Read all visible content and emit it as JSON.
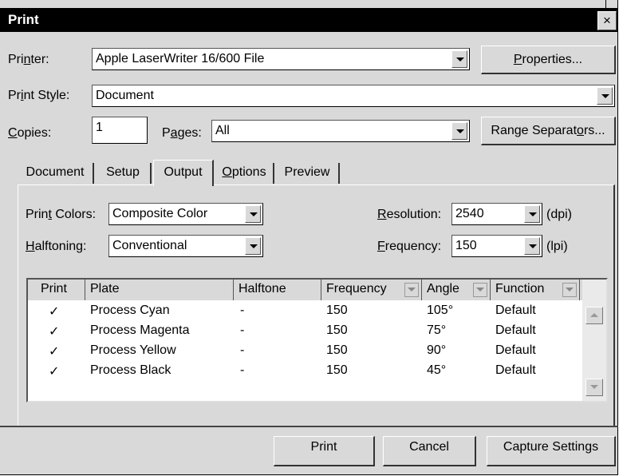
{
  "dialog": {
    "title": "Print",
    "close": "×"
  },
  "printer": {
    "label_pre": "Pri",
    "label_key": "n",
    "label_post": "ter:",
    "value": "Apple LaserWriter 16/600 File",
    "properties_pre": "",
    "properties_key": "P",
    "properties_post": "roperties..."
  },
  "print_style": {
    "label_pre": "Pr",
    "label_key": "i",
    "label_post": "nt Style:",
    "value": "Document"
  },
  "copies": {
    "label_pre": "",
    "label_key": "C",
    "label_post": "opies:",
    "value": "1"
  },
  "pages": {
    "label_pre": "P",
    "label_key": "a",
    "label_post": "ges:",
    "value": "All"
  },
  "range_separators": {
    "pre": "Range Separat",
    "key": "o",
    "post": "rs..."
  },
  "tabs": [
    {
      "label": "Document",
      "active": false
    },
    {
      "label": "Setup",
      "active": false
    },
    {
      "label": "Output",
      "active": true
    },
    {
      "label_pre": "",
      "label_key": "O",
      "label_post": "ptions",
      "active": false
    },
    {
      "label": "Preview",
      "active": false
    }
  ],
  "output": {
    "print_colors": {
      "label_pre": "Prin",
      "label_key": "t",
      "label_post": " Colors:",
      "value": "Composite Color"
    },
    "halftoning": {
      "label_pre": "",
      "label_key": "H",
      "label_post": "alftoning:",
      "value": "Conventional"
    },
    "resolution": {
      "label_pre": "",
      "label_key": "R",
      "label_post": "esolution:",
      "value": "2540",
      "unit": "(dpi)"
    },
    "frequency": {
      "label_pre": "",
      "label_key": "F",
      "label_post": "requency:",
      "value": "150",
      "unit": "(lpi)"
    }
  },
  "plates_table": {
    "columns": [
      "Print",
      "Plate",
      "Halftone",
      "Frequency",
      "Angle",
      "Function"
    ],
    "rows": [
      {
        "print": "✓",
        "plate": "Process Cyan",
        "halftone": "-",
        "frequency": "150",
        "angle": "105°",
        "function": "Default"
      },
      {
        "print": "✓",
        "plate": "Process Magenta",
        "halftone": "-",
        "frequency": "150",
        "angle": "75°",
        "function": "Default"
      },
      {
        "print": "✓",
        "plate": "Process Yellow",
        "halftone": "-",
        "frequency": "150",
        "angle": "90°",
        "function": "Default"
      },
      {
        "print": "✓",
        "plate": "Process Black",
        "halftone": "-",
        "frequency": "150",
        "angle": "45°",
        "function": "Default"
      }
    ]
  },
  "buttons": {
    "print": "Print",
    "cancel": "Cancel",
    "capture": "Capture Settings"
  },
  "colors": {
    "dialog_bg": "#d9d9d9",
    "title_bg": "#000000",
    "field_bg": "#ffffff"
  }
}
